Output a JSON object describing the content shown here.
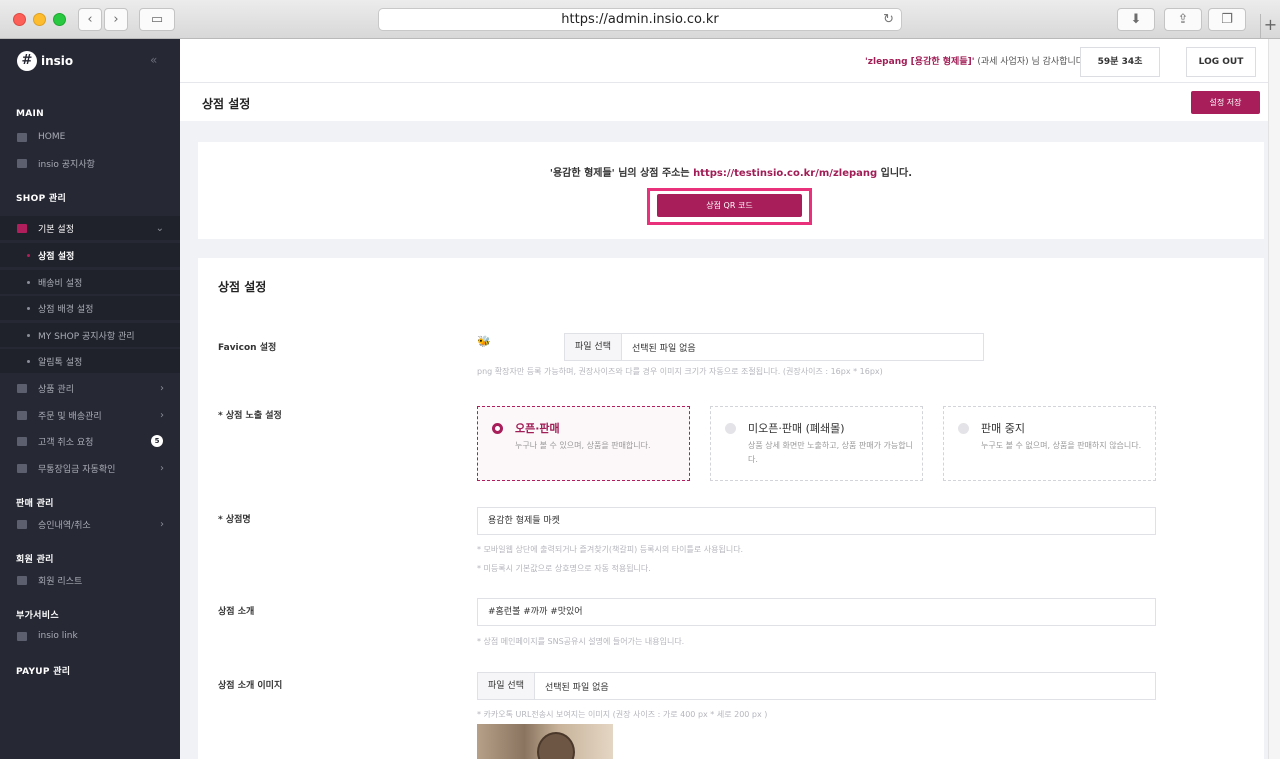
{
  "browser": {
    "url": "https://admin.insio.co.kr"
  },
  "sidebar": {
    "logo_text": "insio",
    "collapse_glyph": "«",
    "sections": {
      "main": "MAIN",
      "shop": "SHOP 관리",
      "sales": "판매 관리",
      "members": "회원 관리",
      "addon": "부가서비스",
      "payup": "PAYUP 관리"
    },
    "items": {
      "home": "HOME",
      "notice": "insio 공지사항",
      "basic_settings": "기본 설정",
      "shop_settings": "상점 설정",
      "shipping_settings": "배송비 설정",
      "background_settings": "상점 배경 설정",
      "myshop_notice": "MY SHOP 공지사항 관리",
      "alimtalk": "알림톡 설정",
      "products": "상품 관리",
      "orders": "주문 및 배송관리",
      "cancel_requests": "고객 취소 요청",
      "cancel_badge": "5",
      "deposit_check": "무통장입금 자동확인",
      "approvals": "승인내역/취소",
      "member_list": "회원 리스트",
      "insio_link": "insio link"
    }
  },
  "header": {
    "greeting_user": "'zlepang [용감한 형제들]'",
    "greeting_rest": " (과세 사업자) 님 감사합니다.",
    "timer": "59분 34초",
    "logout": "LOG OUT"
  },
  "page": {
    "title": "상점 설정",
    "save_button": "설정 저장"
  },
  "address_card": {
    "prefix": "'용감한 형제들' 님의 상점 주소는 ",
    "link": "https://testinsio.co.kr/m/zlepang",
    "suffix": " 입니다.",
    "qr_button": "상점 QR 코드"
  },
  "settings": {
    "section_title": "상점 설정",
    "favicon": {
      "label": "Favicon 설정",
      "file_button": "파일 선택",
      "file_value": "선택된 파일 없음",
      "hint": "png 확장자만 등록 가능하며, 권장사이즈와 다를 경우 이미지 크기가 자동으로 조절됩니다. (권장사이즈 : 16px * 16px)"
    },
    "exposure": {
      "label": "* 상점 노출 설정",
      "options": [
        {
          "title": "오픈·판매",
          "desc": "누구나 볼 수 있으며, 상품을 판매합니다.",
          "selected": true
        },
        {
          "title": "미오픈·판매 (폐쇄몰)",
          "desc": "상품 상세 화면만 노출하고, 상품 판매가 가능합니다.",
          "selected": false
        },
        {
          "title": "판매 중지",
          "desc": "누구도 볼 수 없으며, 상품을 판매하지 않습니다.",
          "selected": false
        }
      ]
    },
    "shop_name": {
      "label": "* 상점명",
      "value": "용감한 형제들 마켓",
      "hint1": "* 모바일웹 상단에 출력되거나 즐겨찾기(책갈피) 등록시의 타이틀로 사용됩니다.",
      "hint2": "* 미등록시 기본값으로 상호명으로 자동 적용됩니다."
    },
    "shop_intro": {
      "label": "상점 소개",
      "value": "#홈런볼 #까까 #맛있어",
      "hint": "* 상점 메인페이지를 SNS공유시 설명에 들어가는 내용입니다."
    },
    "intro_image": {
      "label": "상점 소개 이미지",
      "file_button": "파일 선택",
      "file_value": "선택된 파일 없음",
      "hint": "* 카카오톡 URL전송시 보여지는 이미지 (권장 사이즈 : 가로 400 px * 세로 200 px )"
    }
  }
}
